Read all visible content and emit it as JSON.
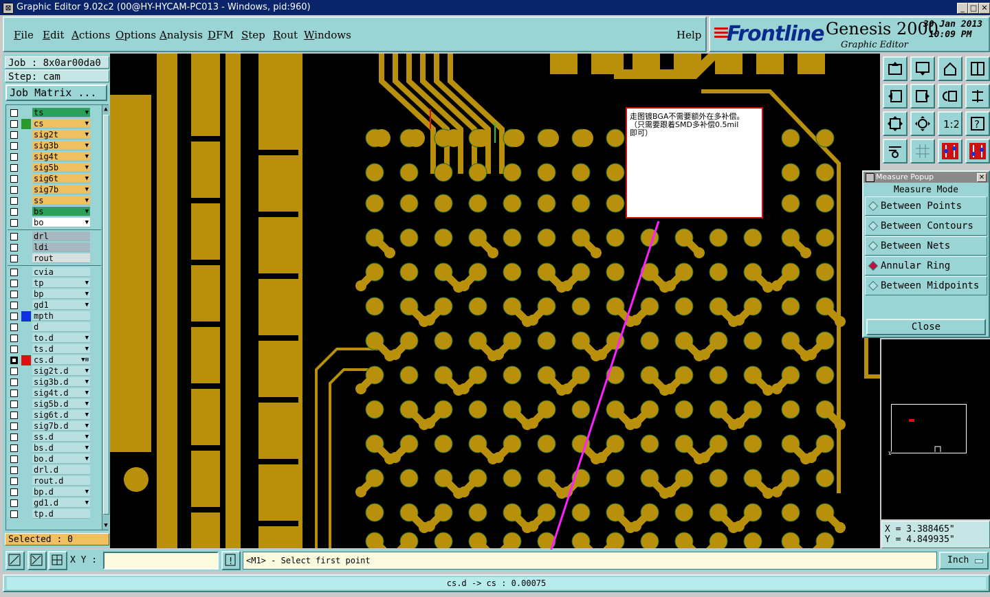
{
  "window": {
    "title": "Graphic Editor 9.02c2 (00@HY-HYCAM-PC013 - Windows, pid:960)"
  },
  "menu": {
    "items": [
      {
        "u": "F",
        "rest": "ile"
      },
      {
        "u": "E",
        "rest": "dit"
      },
      {
        "u": "A",
        "rest": "ctions"
      },
      {
        "u": "O",
        "rest": "ptions"
      },
      {
        "u": "A",
        "rest": "nalysis"
      },
      {
        "u": "D",
        "rest": "FM"
      },
      {
        "u": "S",
        "rest": "tep"
      },
      {
        "u": "R",
        "rest": "out"
      },
      {
        "u": "W",
        "rest": "indows"
      }
    ],
    "help": "Help"
  },
  "brand": {
    "logo": "Frontline",
    "product": "Genesis 2000",
    "subtitle": "Graphic Editor",
    "date": "30 Jan 2013",
    "time": "10:09 PM"
  },
  "job": {
    "job_line": "Job : 8x0ar00da0",
    "step_line": "Step: cam",
    "matrix_button": "Job Matrix ...",
    "selected": "Selected : 0"
  },
  "layers": [
    {
      "name": "ts",
      "bg": "#2aa05a",
      "color": "",
      "mark": "▼",
      "fg": "#000"
    },
    {
      "name": "cs",
      "bg": "#f0c060",
      "color": "#2a9a2a",
      "mark": "▼",
      "fg": "#000"
    },
    {
      "name": "sig2t",
      "bg": "#f0c060",
      "color": "",
      "mark": "▼",
      "fg": "#000"
    },
    {
      "name": "sig3b",
      "bg": "#f0c060",
      "color": "",
      "mark": "▼",
      "fg": "#000"
    },
    {
      "name": "sig4t",
      "bg": "#f0c060",
      "color": "",
      "mark": "▼",
      "fg": "#000"
    },
    {
      "name": "sig5b",
      "bg": "#f0c060",
      "color": "",
      "mark": "▼",
      "fg": "#000"
    },
    {
      "name": "sig6t",
      "bg": "#f0c060",
      "color": "",
      "mark": "▼",
      "fg": "#000"
    },
    {
      "name": "sig7b",
      "bg": "#f0c060",
      "color": "",
      "mark": "▼",
      "fg": "#000"
    },
    {
      "name": "ss",
      "bg": "#f0c060",
      "color": "",
      "mark": "▼",
      "fg": "#000"
    },
    {
      "name": "bs",
      "bg": "#2aa05a",
      "color": "",
      "mark": "▼",
      "fg": "#000"
    },
    {
      "name": "bo",
      "bg": "#ffffff",
      "color": "",
      "mark": "▼",
      "fg": "#000"
    },
    {
      "name": "drl",
      "bg": "#a8b8c0",
      "color": "",
      "mark": "",
      "fg": "#000"
    },
    {
      "name": "ldi",
      "bg": "#a8b8c0",
      "color": "",
      "mark": "",
      "fg": "#000"
    },
    {
      "name": "rout",
      "bg": "#d8e0e0",
      "color": "",
      "mark": "",
      "fg": "#000"
    },
    {
      "name": "cvia",
      "bg": "#b9e0e0",
      "color": "",
      "mark": "",
      "fg": "#000"
    },
    {
      "name": "tp",
      "bg": "#b9e0e0",
      "color": "",
      "mark": "▼",
      "fg": "#000"
    },
    {
      "name": "bp",
      "bg": "#b9e0e0",
      "color": "",
      "mark": "▼",
      "fg": "#000"
    },
    {
      "name": "gd1",
      "bg": "#b9e0e0",
      "color": "",
      "mark": "▼",
      "fg": "#000"
    },
    {
      "name": "mpth",
      "bg": "#b9e0e0",
      "color": "#1030e0",
      "mark": "",
      "fg": "#000"
    },
    {
      "name": "d",
      "bg": "#b9e0e0",
      "color": "",
      "mark": "",
      "fg": "#000"
    },
    {
      "name": "to.d",
      "bg": "#b9e0e0",
      "color": "",
      "mark": "▼",
      "fg": "#000"
    },
    {
      "name": "ts.d",
      "bg": "#b9e0e0",
      "color": "",
      "mark": "▼",
      "fg": "#000"
    },
    {
      "name": "cs.d",
      "bg": "#b9e0e0",
      "color": "#e01010",
      "mark": "▼⊞",
      "fg": "#000",
      "checked": true
    },
    {
      "name": "sig2t.d",
      "bg": "#b9e0e0",
      "color": "",
      "mark": "▼",
      "fg": "#000"
    },
    {
      "name": "sig3b.d",
      "bg": "#b9e0e0",
      "color": "",
      "mark": "▼",
      "fg": "#000"
    },
    {
      "name": "sig4t.d",
      "bg": "#b9e0e0",
      "color": "",
      "mark": "▼",
      "fg": "#000"
    },
    {
      "name": "sig5b.d",
      "bg": "#b9e0e0",
      "color": "",
      "mark": "▼",
      "fg": "#000"
    },
    {
      "name": "sig6t.d",
      "bg": "#b9e0e0",
      "color": "",
      "mark": "▼",
      "fg": "#000"
    },
    {
      "name": "sig7b.d",
      "bg": "#b9e0e0",
      "color": "",
      "mark": "▼",
      "fg": "#000"
    },
    {
      "name": "ss.d",
      "bg": "#b9e0e0",
      "color": "",
      "mark": "▼",
      "fg": "#000"
    },
    {
      "name": "bs.d",
      "bg": "#b9e0e0",
      "color": "",
      "mark": "▼",
      "fg": "#000"
    },
    {
      "name": "bo.d",
      "bg": "#b9e0e0",
      "color": "",
      "mark": "▼",
      "fg": "#000"
    },
    {
      "name": "drl.d",
      "bg": "#b9e0e0",
      "color": "",
      "mark": "",
      "fg": "#000"
    },
    {
      "name": "rout.d",
      "bg": "#b9e0e0",
      "color": "",
      "mark": "",
      "fg": "#000"
    },
    {
      "name": "bp.d",
      "bg": "#b9e0e0",
      "color": "",
      "mark": "▼",
      "fg": "#000"
    },
    {
      "name": "gd1.d",
      "bg": "#b9e0e0",
      "color": "",
      "mark": "▼",
      "fg": "#000"
    },
    {
      "name": "tp.d",
      "bg": "#b9e0e0",
      "color": "",
      "mark": "",
      "fg": "#000"
    }
  ],
  "note": {
    "line1": "走图镀BGA不需要额外在多补偿。",
    "line2": "（只需要跟着SMD多补偿0.5mil",
    "line3": "即可）"
  },
  "measure": {
    "title": "Measure Popup",
    "mode": "Measure Mode",
    "options": [
      {
        "label": "Between Points",
        "selected": false
      },
      {
        "label": "Between Contours",
        "selected": false
      },
      {
        "label": "Between Nets",
        "selected": false
      },
      {
        "label": "Annular Ring",
        "selected": true
      },
      {
        "label": "Between Midpoints",
        "selected": false
      }
    ],
    "close": "Close"
  },
  "coords": {
    "x": "X = 3.388465\"",
    "y": "Y = 4.849935\""
  },
  "bottom": {
    "xy_label": "X Y :",
    "xy_value": "",
    "status": "<M1> - Select first point",
    "unit": "Inch"
  },
  "footer": {
    "text": "cs.d -> cs : 0.00075"
  },
  "colors": {
    "copper": "#b8900c",
    "background": "#000000",
    "panel": "#9bd4d4",
    "arrow": "#ff20ff",
    "note_border": "#d01010"
  }
}
